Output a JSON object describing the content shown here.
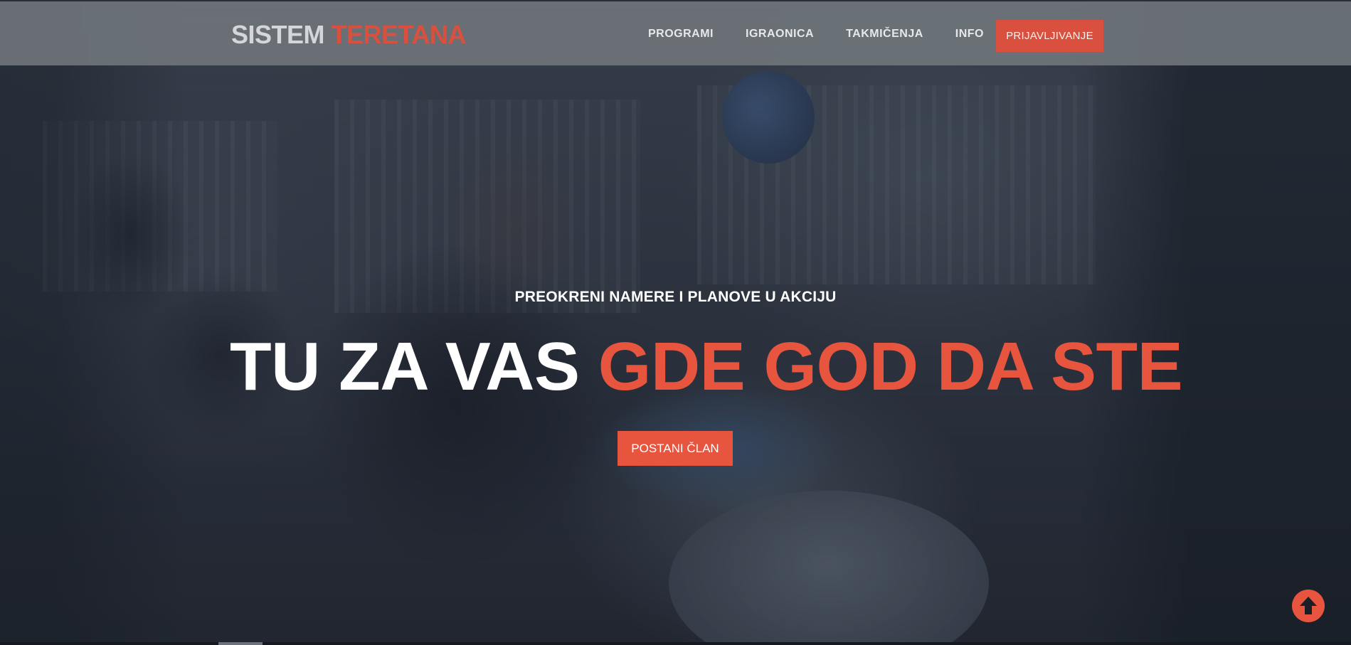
{
  "header": {
    "logo_part1": "SISTEM",
    "logo_part2": "TERETANA",
    "nav": [
      {
        "label": "PROGRAMI"
      },
      {
        "label": "IGRAONICA"
      },
      {
        "label": "TAKMIČENJA"
      },
      {
        "label": "INFO"
      }
    ],
    "login_label": "PRIJAVLJIVANJE"
  },
  "hero": {
    "tagline": "PREOKRENI NAMERE I PLANOVE U AKCIJU",
    "headline_white": "TU ZA VAS",
    "headline_accent": "GDE GOD DA STE",
    "cta_label": "POSTANI ČLAN"
  },
  "icons": {
    "back_to_top": "arrow-up-circle-icon"
  },
  "colors": {
    "accent": "#e8553f",
    "header_bg": "#6e747a",
    "logo_light": "#d4d6d9"
  }
}
